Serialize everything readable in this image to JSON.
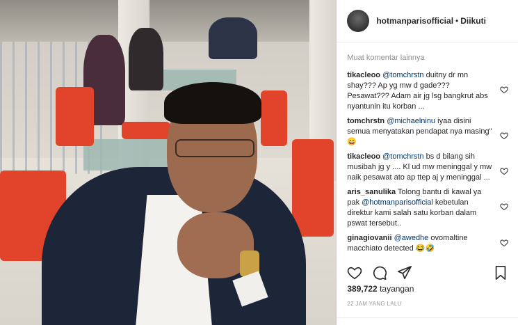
{
  "header": {
    "username": "hotmanparisofficial",
    "separator": "•",
    "follow_status": "Diikuti"
  },
  "load_more": "Muat komentar lainnya",
  "comments": [
    {
      "user": "tikacleoo",
      "mention": "@tomchrstn",
      "text": " duitny dr mn shay??? Ap yg mw d gade??? Pesawat??? Adam air jg lsg bangkrut abs nyantunin itu korban ..."
    },
    {
      "user": "tomchrstn",
      "mention": "@michaelninu",
      "text": " iyaa disini semua menyatakan pendapat nya masing\" 😄"
    },
    {
      "user": "tikacleoo",
      "mention": "@tomchrstn",
      "text": " bs d bilang sih musibah jg y .... Kl ud mw meninggal y mw naik pesawat ato ap ttep aj y meninggal ..."
    },
    {
      "user": "aris_sanulika",
      "mention": "",
      "text": " Tolong bantu di kawal ya pak ",
      "mention2": "@hotmanparisofficial",
      "text2": " kebetulan direktur kami salah satu korban dalam pswat tersebut.."
    },
    {
      "user": "ginagiovanii",
      "mention": "@awedhe",
      "text": " ovomaltine macchiato detected 😂🤣"
    }
  ],
  "stats": {
    "views_count": "389,722",
    "views_label": " tayangan",
    "time_ago": "22 JAM YANG LALU"
  },
  "icons": {
    "like": "heart-icon",
    "comment": "comment-icon",
    "share": "share-icon",
    "save": "bookmark-icon"
  },
  "colors": {
    "mention": "#003569",
    "muted": "#8e8e8e",
    "text": "#262626"
  }
}
